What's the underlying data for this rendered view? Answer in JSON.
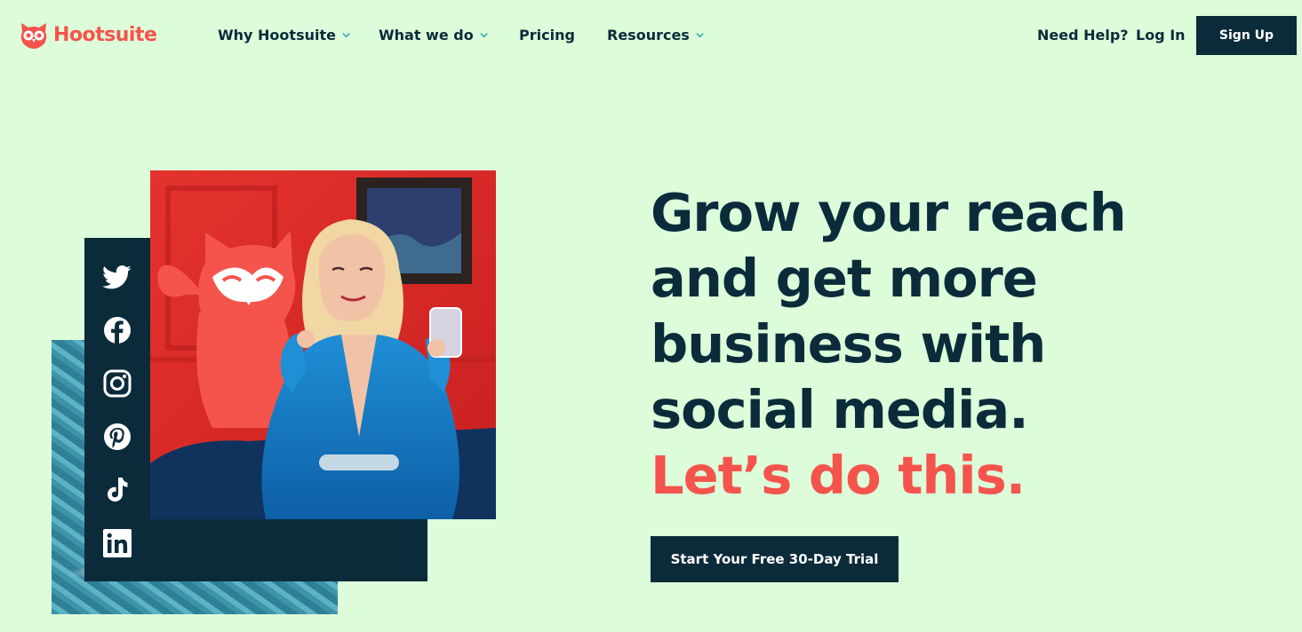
{
  "header": {
    "logo_text": "Hootsuite",
    "nav": [
      {
        "label": "Why Hootsuite",
        "has_dropdown": true
      },
      {
        "label": "What we do",
        "has_dropdown": true
      },
      {
        "label": "Pricing",
        "has_dropdown": false
      },
      {
        "label": "Resources",
        "has_dropdown": true
      }
    ],
    "help_label": "Need Help?",
    "login_label": "Log In",
    "signup_label": "Sign Up"
  },
  "hero": {
    "headline_lines": [
      "Grow your reach",
      "and get more",
      "business with",
      "social media."
    ],
    "headline_accent": "Let’s do this.",
    "cta_label": "Start Your Free 30-Day Trial",
    "social_icons": [
      "twitter-icon",
      "facebook-icon",
      "instagram-icon",
      "pinterest-icon",
      "tiktok-icon",
      "linkedin-icon"
    ]
  },
  "colors": {
    "background": "#dcfcda",
    "navy": "#0b2b3a",
    "brand_red": "#f4544c",
    "white": "#ffffff"
  }
}
